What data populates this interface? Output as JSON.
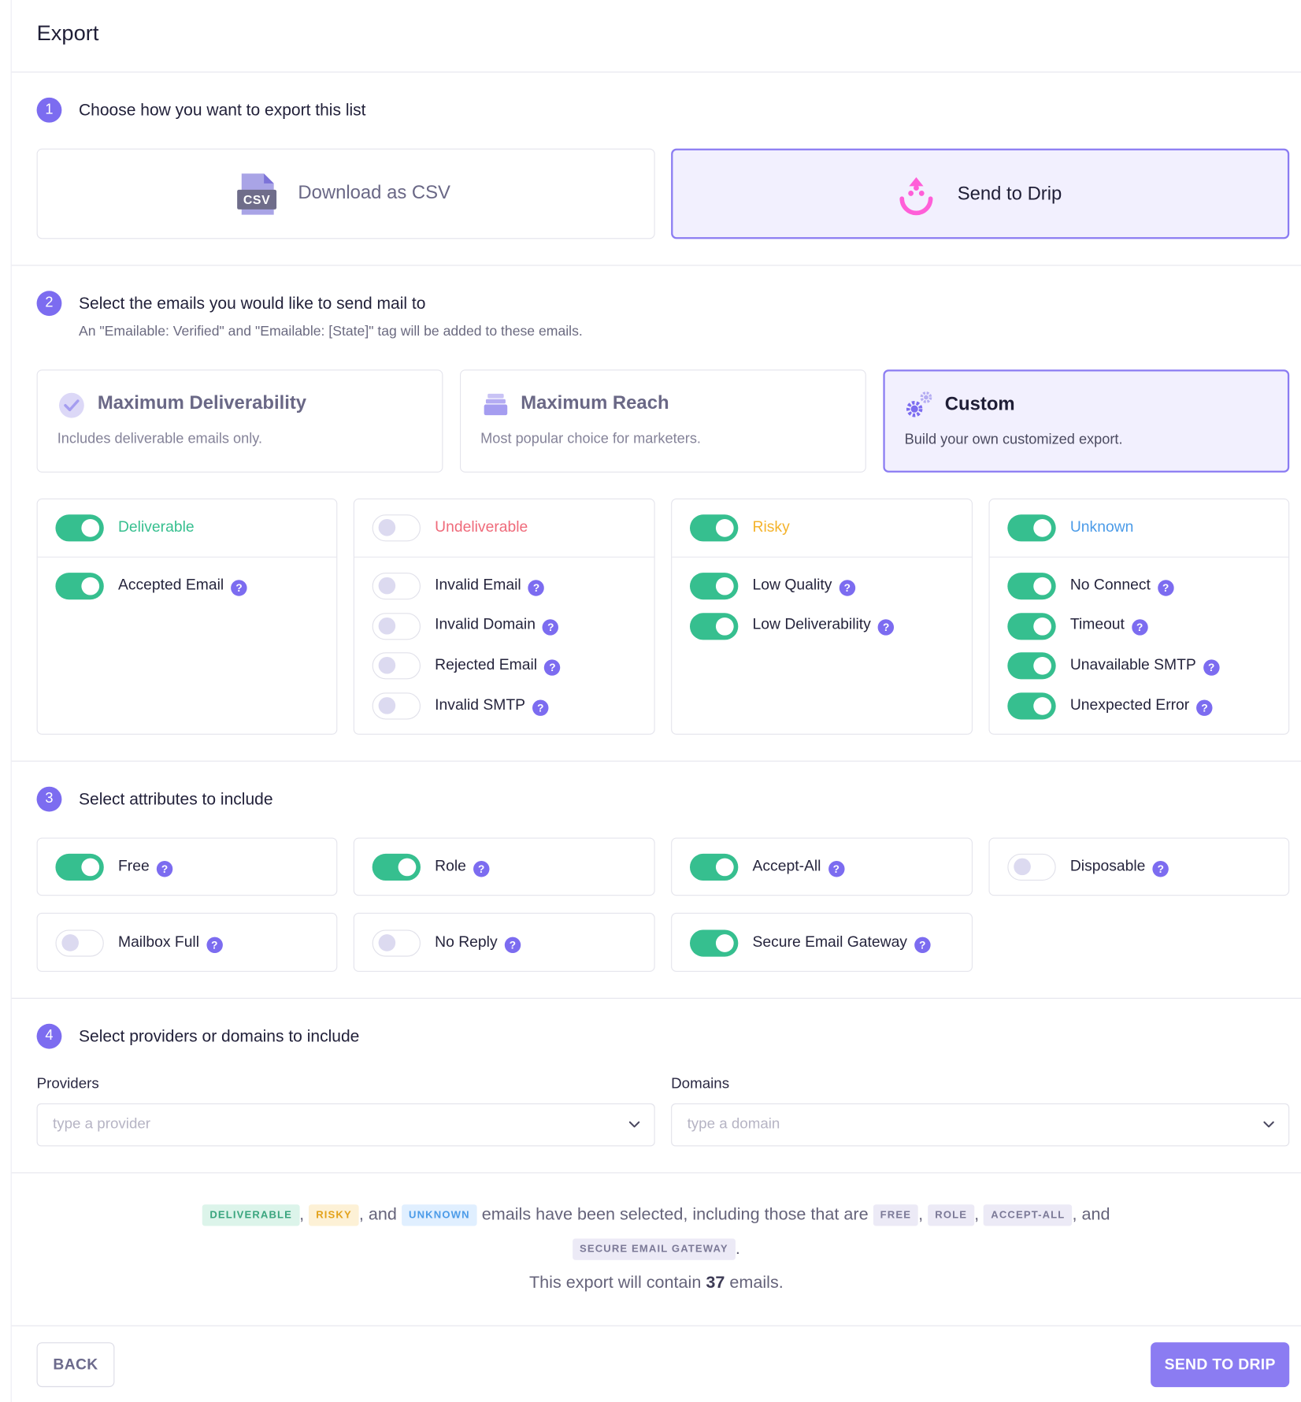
{
  "page": {
    "title": "Export"
  },
  "step1": {
    "number": "1",
    "title": "Choose how you want to export this list",
    "options": [
      {
        "label": "Download as CSV",
        "icon": "csv-file-icon",
        "icon_text": "CSV",
        "selected": false
      },
      {
        "label": "Send to Drip",
        "icon": "drip-logo-icon",
        "selected": true
      }
    ]
  },
  "step2": {
    "number": "2",
    "title": "Select the emails you would like to send mail to",
    "subtitle": "An \"Emailable: Verified\" and \"Emailable: [State]\" tag will be added to these emails.",
    "presets": [
      {
        "title": "Maximum Deliverability",
        "subtitle": "Includes deliverable emails only.",
        "icon": "check-circle-icon",
        "selected": false
      },
      {
        "title": "Maximum Reach",
        "subtitle": "Most popular choice for marketers.",
        "icon": "inbox-icon",
        "selected": false
      },
      {
        "title": "Custom",
        "subtitle": "Build your own customized export.",
        "icon": "gears-icon",
        "selected": true
      }
    ],
    "groups": [
      {
        "title": "Deliverable",
        "color": "#36bf8f",
        "on": true,
        "items": [
          {
            "label": "Accepted Email",
            "on": true
          }
        ]
      },
      {
        "title": "Undeliverable",
        "color": "#ef6a7a",
        "on": false,
        "items": [
          {
            "label": "Invalid Email",
            "on": false
          },
          {
            "label": "Invalid Domain",
            "on": false
          },
          {
            "label": "Rejected Email",
            "on": false
          },
          {
            "label": "Invalid SMTP",
            "on": false
          }
        ]
      },
      {
        "title": "Risky",
        "color": "#f4b32c",
        "on": true,
        "items": [
          {
            "label": "Low Quality",
            "on": true
          },
          {
            "label": "Low Deliverability",
            "on": true
          }
        ]
      },
      {
        "title": "Unknown",
        "color": "#4b9be8",
        "on": true,
        "items": [
          {
            "label": "No Connect",
            "on": true
          },
          {
            "label": "Timeout",
            "on": true
          },
          {
            "label": "Unavailable SMTP",
            "on": true
          },
          {
            "label": "Unexpected Error",
            "on": true
          }
        ]
      }
    ]
  },
  "step3": {
    "number": "3",
    "title": "Select attributes to include",
    "attributes": [
      {
        "label": "Free",
        "on": true
      },
      {
        "label": "Role",
        "on": true
      },
      {
        "label": "Accept-All",
        "on": true
      },
      {
        "label": "Disposable",
        "on": false
      },
      {
        "label": "Mailbox Full",
        "on": false
      },
      {
        "label": "No Reply",
        "on": false
      },
      {
        "label": "Secure Email Gateway",
        "on": true
      }
    ]
  },
  "step4": {
    "number": "4",
    "title": "Select providers or domains to include",
    "providers": {
      "label": "Providers",
      "placeholder": "type a provider"
    },
    "domains": {
      "label": "Domains",
      "placeholder": "type a domain"
    }
  },
  "summary": {
    "tag_deliverable": "DELIVERABLE",
    "tag_risky": "RISKY",
    "tag_unknown": "UNKNOWN",
    "comma": ",",
    "and": ", and",
    "mid_text": "emails have been selected, including those that are",
    "tag_free": "FREE",
    "tag_role": "ROLE",
    "tag_accept_all": "ACCEPT-ALL",
    "tag_seg": "SECURE EMAIL GATEWAY",
    "period": ".",
    "count_prefix": "This export will contain",
    "count": "37",
    "count_suffix": "emails."
  },
  "footer": {
    "back_label": "BACK",
    "primary_label": "SEND TO DRIP"
  },
  "colors": {
    "accent": "#8b7cf2",
    "toggle_on": "#36bf8f",
    "help": "#7c6cf0"
  }
}
